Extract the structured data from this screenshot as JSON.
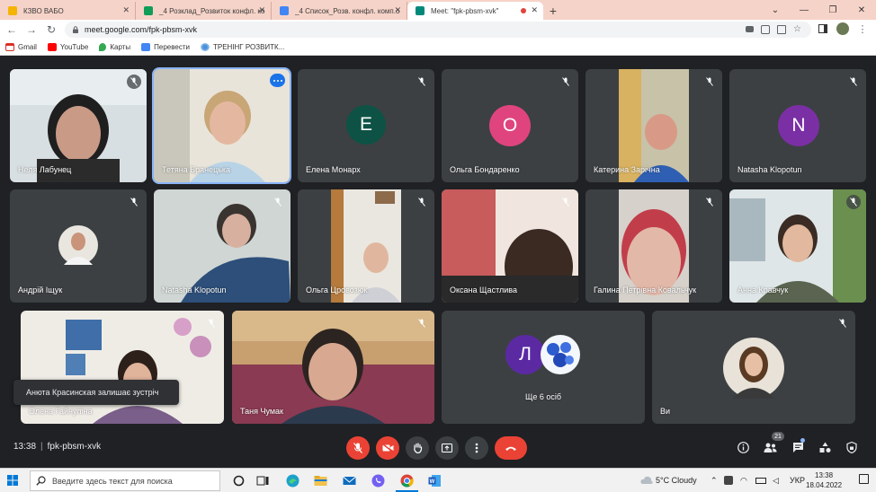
{
  "browser": {
    "tabs": [
      {
        "title": "КЗВО ВАБО",
        "favicon_color": "#f4b400"
      },
      {
        "title": "_4 Розклад_Розвиток конфл. ко",
        "favicon_color": "#0f9d58"
      },
      {
        "title": "_4 Список_Розв. конфл. комп.о",
        "favicon_color": "#4285f4"
      },
      {
        "title": "Meet: \"fpk-pbsm-xvk\"",
        "favicon_color": "#00897b"
      }
    ],
    "new_tab": "+",
    "url": "meet.google.com/fpk-pbsm-xvk",
    "bookmarks": [
      {
        "label": "Gmail",
        "icon": "gmail-icon"
      },
      {
        "label": "YouTube",
        "icon": "youtube-icon"
      },
      {
        "label": "Карты",
        "icon": "maps-icon"
      },
      {
        "label": "Перевести",
        "icon": "translate-icon"
      },
      {
        "label": "ТРЕНІНГ РОЗВИТК...",
        "icon": "bookmark-icon"
      }
    ]
  },
  "meet": {
    "participants": [
      {
        "name": "Неля Лабунец"
      },
      {
        "name": "Тетяна Бранецька"
      },
      {
        "name": "Елена Монарх",
        "initial": "E",
        "avatar_color": "#0d5245"
      },
      {
        "name": "Ольга Бондаренко",
        "initial": "O",
        "avatar_color": "#e0447e"
      },
      {
        "name": "Катерина Зарічна"
      },
      {
        "name": "Natasha Klopotun",
        "initial": "N",
        "avatar_color": "#7b2fa5"
      },
      {
        "name": "Андрій Іщук"
      },
      {
        "name": "Natasha Klopotun"
      },
      {
        "name": "Ольга Цровозюк"
      },
      {
        "name": "Оксана Щастлива"
      },
      {
        "name": "Галина Петрівна Ковальчук"
      },
      {
        "name": "Анна Кравчук"
      },
      {
        "name": "Олена Гайнуліна"
      },
      {
        "name": "Таня Чумак"
      }
    ],
    "others_tile": {
      "initial": "Л",
      "avatar_color": "#5b2aa3",
      "label": "Ще 6 осіб"
    },
    "self_tile": {
      "label": "Ви"
    },
    "toast": "Анюта Красинская залишає зустріч",
    "time": "13:38",
    "meeting_code": "fpk-pbsm-xvk",
    "participant_count": "21"
  },
  "taskbar": {
    "search_placeholder": "Введите здесь текст для поиска",
    "weather": "5°C  Cloudy",
    "language": "УКР",
    "time": "13:38",
    "date": "18.04.2022"
  }
}
